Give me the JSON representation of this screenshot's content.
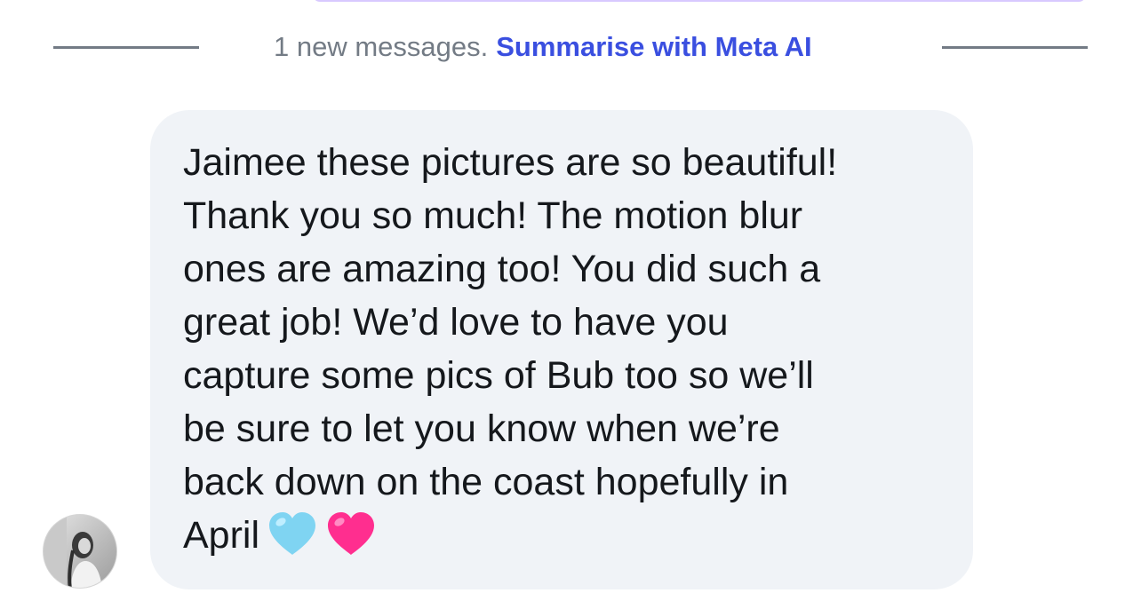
{
  "divider": {
    "count_text": "1 new messages.",
    "summarise_link": "Summarise with Meta AI"
  },
  "message": {
    "text": "Jaimee these pictures are so beautiful!\nThank you so much!  The motion blur\nones are amazing too! You did such a\ngreat job! We’d love to have you\ncapture some pics of Bub too so we’ll\nbe sure to let you know when we’re\nback down on the coast hopefully in\nApril",
    "emojis": [
      "light-blue-heart-icon",
      "pink-heart-icon"
    ]
  },
  "colors": {
    "accent": "#3a4fe0",
    "muted_text": "#737b85",
    "bubble_bg": "#f0f3f7",
    "light_blue_heart": "#7fd4f2",
    "pink_heart": "#ff2e8f"
  }
}
